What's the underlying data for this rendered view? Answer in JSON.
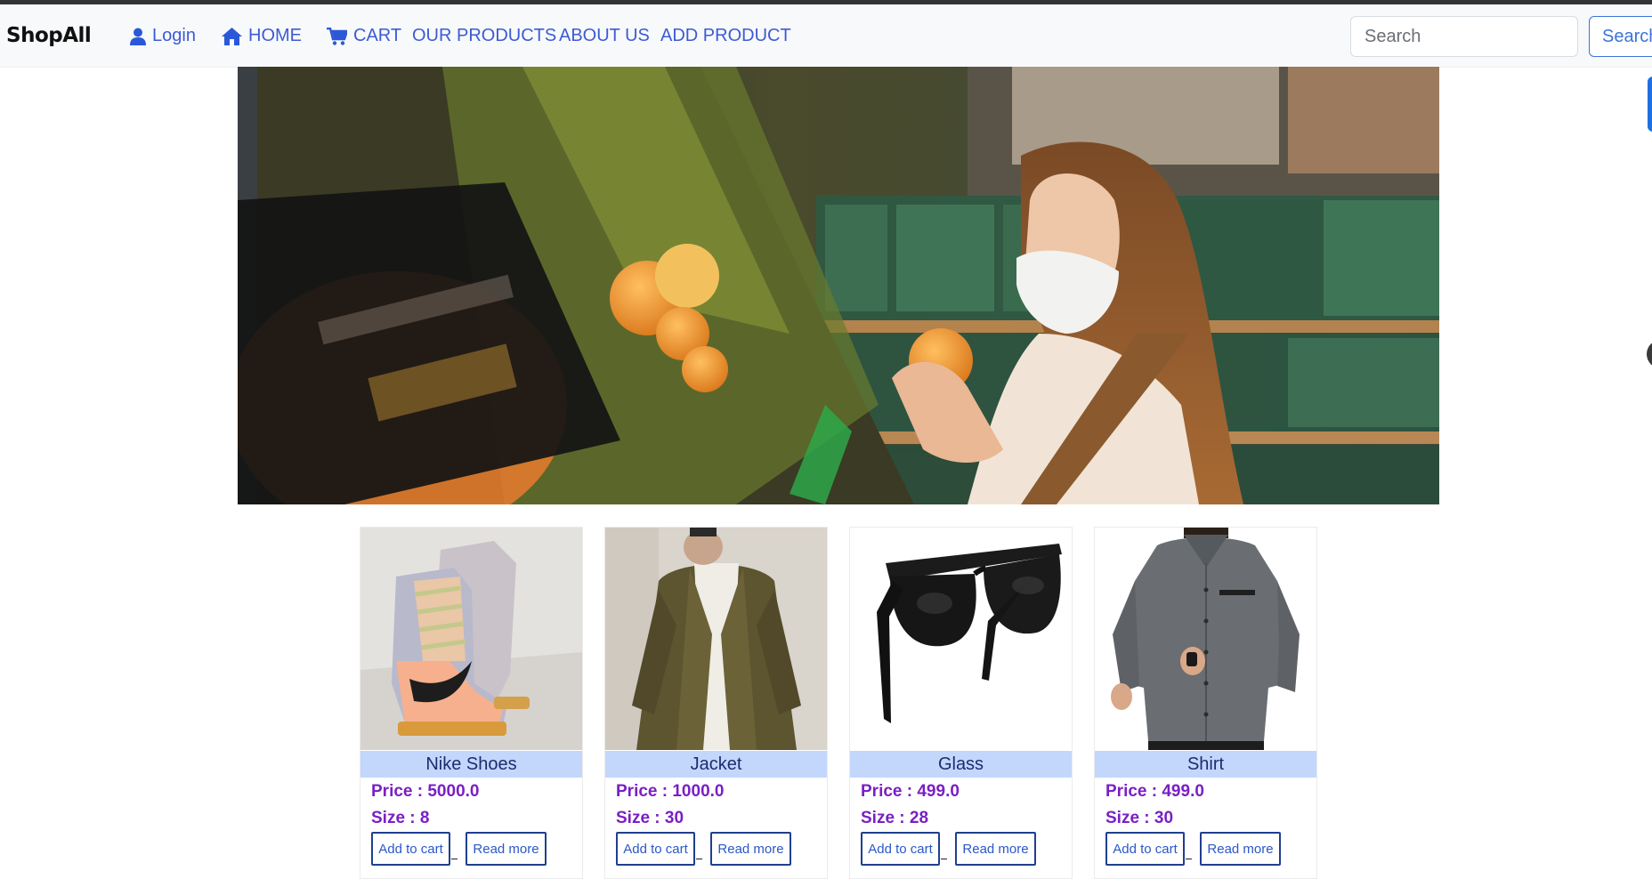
{
  "navbar": {
    "brand": "ShopAll",
    "links": [
      {
        "label": "Login",
        "icon": "user-icon"
      },
      {
        "label": "HOME",
        "icon": "home-icon"
      },
      {
        "label": "CART",
        "icon": "cart-icon"
      },
      {
        "label": "OUR PRODUCTS"
      },
      {
        "label": "ABOUT US"
      },
      {
        "label": "ADD PRODUCT"
      }
    ],
    "search": {
      "placeholder": "Search",
      "value": "",
      "button_label": "Search"
    }
  },
  "colors": {
    "link": "#3c5bd6",
    "price": "#7a1fc4",
    "product_name_bg": "#c3d7fd",
    "button_border": "#1f3f8f"
  },
  "products": [
    {
      "name": "Nike Shoes",
      "price": "Price : 5000.0",
      "size": "Size : 8",
      "add_label": "Add to cart",
      "read_label": "Read more"
    },
    {
      "name": "Jacket",
      "price": "Price : 1000.0",
      "size": "Size : 30",
      "add_label": "Add to cart",
      "read_label": "Read more"
    },
    {
      "name": "Glass",
      "price": "Price : 499.0",
      "size": "Size : 28",
      "add_label": "Add to cart",
      "read_label": "Read more"
    },
    {
      "name": "Shirt",
      "price": "Price : 499.0",
      "size": "Size : 30",
      "add_label": "Add to cart",
      "read_label": "Read more"
    }
  ]
}
